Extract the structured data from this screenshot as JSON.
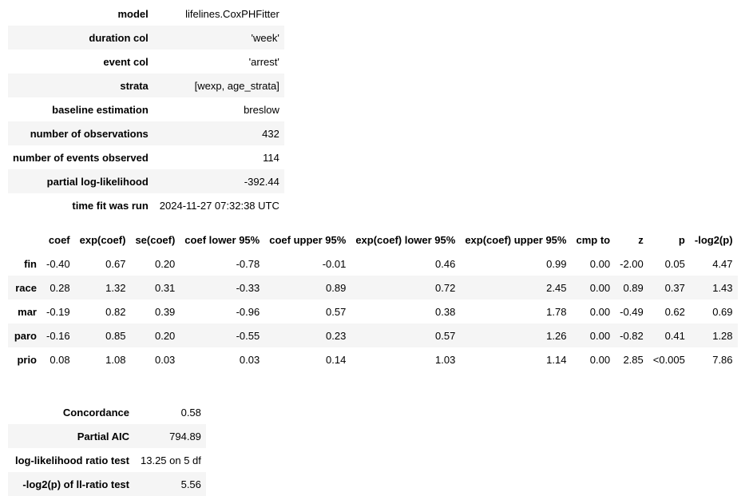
{
  "summary": [
    {
      "label": "model",
      "value": "lifelines.CoxPHFitter"
    },
    {
      "label": "duration col",
      "value": "'week'"
    },
    {
      "label": "event col",
      "value": "'arrest'"
    },
    {
      "label": "strata",
      "value": "[wexp, age_strata]"
    },
    {
      "label": "baseline estimation",
      "value": "breslow"
    },
    {
      "label": "number of observations",
      "value": "432"
    },
    {
      "label": "number of events observed",
      "value": "114"
    },
    {
      "label": "partial log-likelihood",
      "value": "-392.44"
    },
    {
      "label": "time fit was run",
      "value": "2024-11-27 07:32:38 UTC"
    }
  ],
  "coef_table": {
    "columns": [
      "",
      "coef",
      "exp(coef)",
      "se(coef)",
      "coef lower 95%",
      "coef upper 95%",
      "exp(coef) lower 95%",
      "exp(coef) upper 95%",
      "cmp to",
      "z",
      "p",
      "-log2(p)"
    ],
    "rows": [
      {
        "name": "fin",
        "values": [
          "-0.40",
          "0.67",
          "0.20",
          "-0.78",
          "-0.01",
          "0.46",
          "0.99",
          "0.00",
          "-2.00",
          "0.05",
          "4.47"
        ]
      },
      {
        "name": "race",
        "values": [
          "0.28",
          "1.32",
          "0.31",
          "-0.33",
          "0.89",
          "0.72",
          "2.45",
          "0.00",
          "0.89",
          "0.37",
          "1.43"
        ]
      },
      {
        "name": "mar",
        "values": [
          "-0.19",
          "0.82",
          "0.39",
          "-0.96",
          "0.57",
          "0.38",
          "1.78",
          "0.00",
          "-0.49",
          "0.62",
          "0.69"
        ]
      },
      {
        "name": "paro",
        "values": [
          "-0.16",
          "0.85",
          "0.20",
          "-0.55",
          "0.23",
          "0.57",
          "1.26",
          "0.00",
          "-0.82",
          "0.41",
          "1.28"
        ]
      },
      {
        "name": "prio",
        "values": [
          "0.08",
          "1.08",
          "0.03",
          "0.03",
          "0.14",
          "1.03",
          "1.14",
          "0.00",
          "2.85",
          "<0.005",
          "7.86"
        ]
      }
    ]
  },
  "fit_stats": [
    {
      "label": "Concordance",
      "value": "0.58"
    },
    {
      "label": "Partial AIC",
      "value": "794.89"
    },
    {
      "label": "log-likelihood ratio test",
      "value": "13.25 on 5 df"
    },
    {
      "label": "-log2(p) of ll-ratio test",
      "value": "5.56"
    }
  ],
  "colors": {
    "row_shade": "#f5f5f5",
    "text": "#000000",
    "background": "#ffffff"
  }
}
